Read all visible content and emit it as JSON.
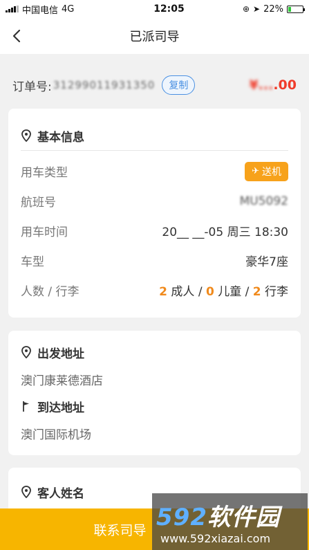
{
  "status_bar": {
    "carrier": "中国电信",
    "network": "4G",
    "time": "12:05",
    "battery": "22%",
    "battery_level": 0.22
  },
  "nav": {
    "title": "已派司导"
  },
  "order": {
    "label": "订单号:",
    "number": "31299011931350",
    "copy_label": "复制",
    "price_blurred": "¥...",
    "price_suffix": ".00"
  },
  "basic_info": {
    "title": "基本信息",
    "rows": [
      {
        "label": "用车类型",
        "tag": "送机"
      },
      {
        "label": "航班号",
        "value": "MU5092"
      },
      {
        "label": "用车时间",
        "value": "20__ __-05 周三 18:30"
      },
      {
        "label": "车型",
        "value": "豪华7座"
      },
      {
        "label": "人数 / 行李"
      }
    ],
    "passengers": {
      "adults": "2",
      "adults_label": "成人",
      "children": "0",
      "children_label": "儿童",
      "luggage": "2",
      "luggage_label": "行李",
      "sep": "/"
    }
  },
  "address": {
    "from_title": "出发地址",
    "from": "澳门康莱德酒店",
    "to_title": "到达地址",
    "to": "澳门国际机场"
  },
  "guest": {
    "title": "客人姓名"
  },
  "bottom": {
    "contact_label": "联系司导"
  },
  "watermark": {
    "brand_num": "592",
    "brand_text": "软件园",
    "url": "www.592xiazai.com"
  },
  "colors": {
    "accent": "#f7b500",
    "tag": "#f7a21b",
    "price": "#f03c2b",
    "link": "#4a90e2"
  }
}
